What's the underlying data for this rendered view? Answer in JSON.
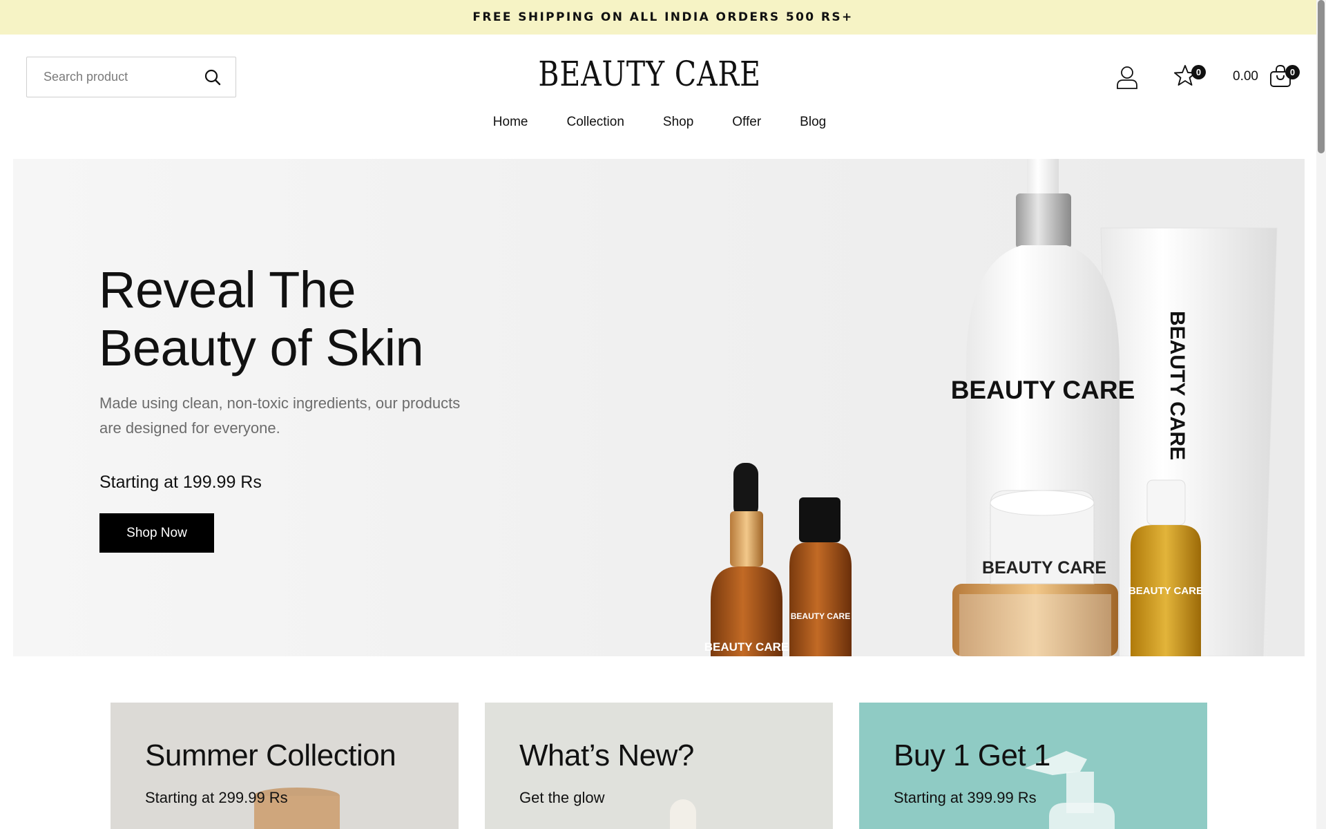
{
  "announcement": "FREE SHIPPING ON ALL INDIA ORDERS 500 RS+",
  "search": {
    "placeholder": "Search product"
  },
  "logo": "BEAUTY CARE",
  "header": {
    "wishlist_count": "0",
    "cart_total": "0.00",
    "cart_count": "0"
  },
  "nav": {
    "items": [
      "Home",
      "Collection",
      "Shop",
      "Offer",
      "Blog"
    ]
  },
  "hero": {
    "title_line1": "Reveal The",
    "title_line2": "Beauty of Skin",
    "subtitle": "Made using clean, non-toxic ingredients, our products are designed for everyone.",
    "price": "Starting at 199.99 Rs",
    "button": "Shop Now",
    "product_label": "BEAUTY CARE"
  },
  "promos": [
    {
      "title": "Summer Collection",
      "subtitle": "Starting at 299.99 Rs"
    },
    {
      "title": "What’s New?",
      "subtitle": "Get the glow"
    },
    {
      "title": "Buy 1 Get 1",
      "subtitle": "Starting at 399.99 Rs"
    }
  ],
  "colors": {
    "announcement_bg": "#f6f3c5",
    "button_bg": "#000000",
    "promo3_bg": "#8fcbc4"
  },
  "icons": [
    "search-icon",
    "user-icon",
    "star-icon",
    "cart-icon"
  ]
}
